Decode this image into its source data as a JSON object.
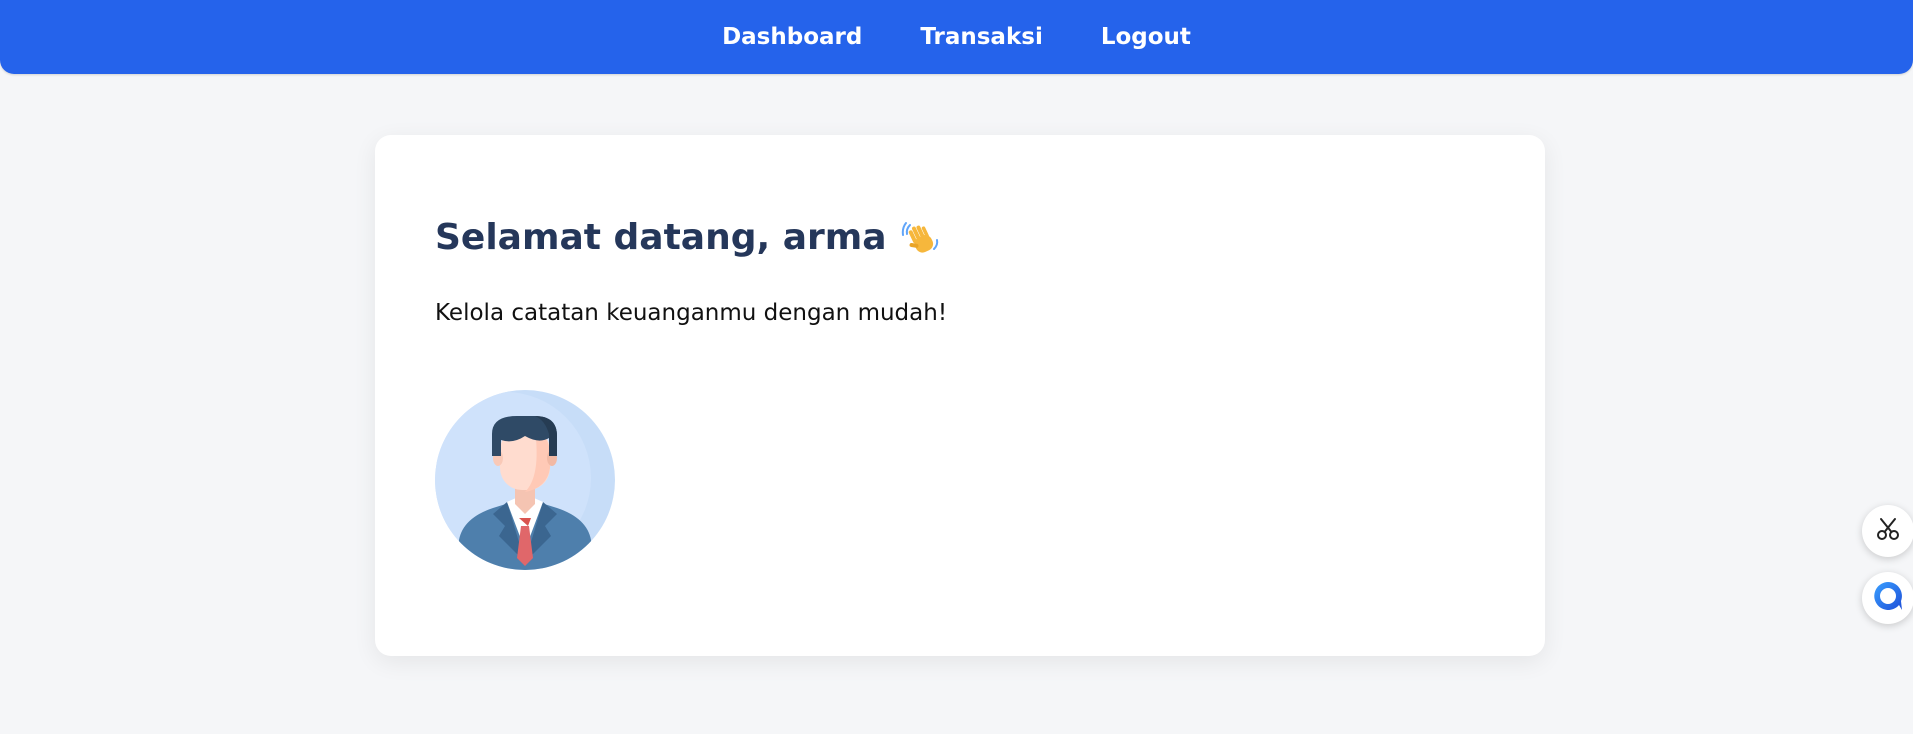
{
  "nav": {
    "items": [
      {
        "label": "Dashboard"
      },
      {
        "label": "Transaksi"
      },
      {
        "label": "Logout"
      }
    ],
    "background_color": "#2563eb"
  },
  "welcome": {
    "title": "Selamat datang, arma",
    "title_icon": "waving-hand-icon",
    "subtitle": "Kelola catatan keuanganmu dengan mudah!",
    "avatar_icon": "businessman-avatar"
  },
  "floating_buttons": [
    {
      "icon": "scissors-icon"
    },
    {
      "icon": "chat-bubble-icon"
    }
  ],
  "colors": {
    "page_bg": "#f5f6f8",
    "card_bg": "#ffffff",
    "title": "#25375a",
    "accent": "#2563eb"
  }
}
